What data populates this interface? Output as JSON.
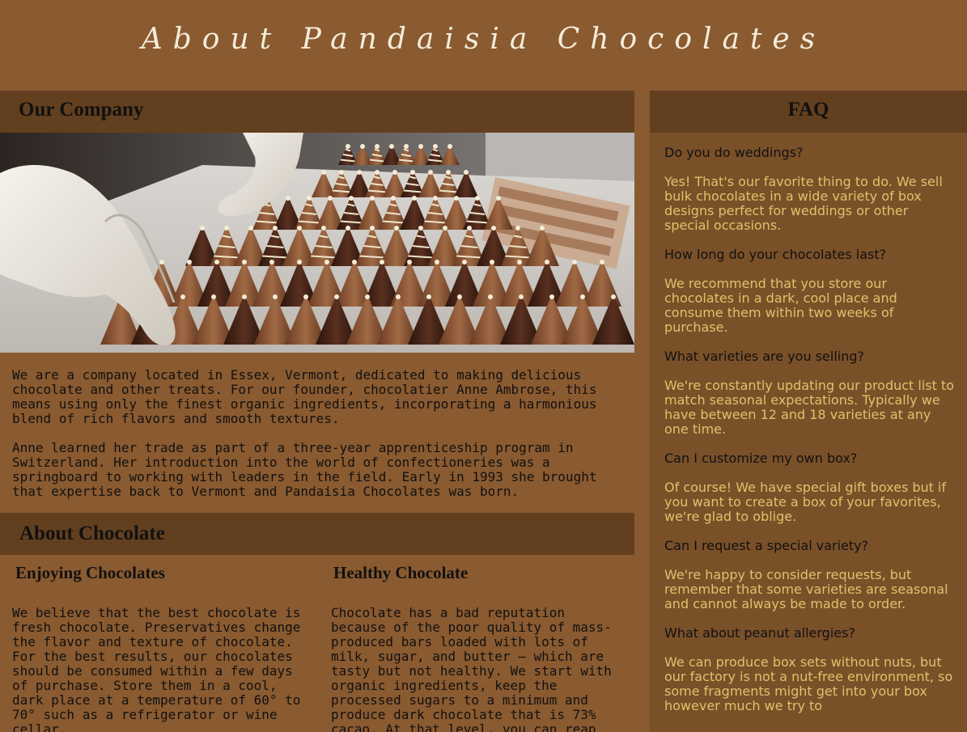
{
  "header": {
    "title": "About Pandaisia Chocolates"
  },
  "company": {
    "heading": "Our Company",
    "image_alt": "Chocolatier arranging striped chocolate cones on a tray",
    "paragraphs": [
      "We are a company located in Essex, Vermont, dedicated to making delicious chocolate and other treats. For our founder, chocolatier Anne Ambrose, this means using only the finest organic ingredients, incorporating a harmonious blend of rich flavors and smooth textures.",
      "Anne learned her trade as part of a three-year apprenticeship program in Switzerland. Her introduction into the world of confectioneries was a springboard to working with leaders in the field. Early in 1993 she brought that expertise back to Vermont and Pandaisia Chocolates was born."
    ]
  },
  "about_chocolate": {
    "heading": "About Chocolate",
    "enjoying": {
      "heading": "Enjoying Chocolates",
      "text": "We believe that the best chocolate is fresh chocolate. Preservatives change the flavor and texture of chocolate. For the best results, our chocolates should be consumed within a few days of purchase. Store them in a cool, dark place at a temperature of 60° to 70° such as a refrigerator or wine cellar."
    },
    "healthy": {
      "heading": "Healthy Chocolate",
      "text": "Chocolate has a bad reputation because of the poor quality of mass-produced bars loaded with lots of milk, sugar, and butter — which are tasty but not healthy. We start with organic ingredients, keep the processed sugars to a minimum and produce dark chocolate that is 73% cacao. At that level, you can reap the benefits of a"
    }
  },
  "faq": {
    "heading": "FAQ",
    "items": [
      {
        "q": "Do you do weddings?",
        "a": "Yes! That's our favorite thing to do. We sell bulk chocolates in a wide variety of box designs perfect for weddings or other special occasions."
      },
      {
        "q": "How long do your chocolates last?",
        "a": "We recommend that you store our chocolates in a dark, cool place and consume them within two weeks of purchase."
      },
      {
        "q": "What varieties are you selling?",
        "a": "We're constantly updating our product list to match seasonal expectations. Typically we have between 12 and 18 varieties at any one time."
      },
      {
        "q": "Can I customize my own box?",
        "a": "Of course! We have special gift boxes but if you want to create a box of your favorites, we're glad to oblige."
      },
      {
        "q": "Can I request a special variety?",
        "a": "We're happy to consider requests, but remember that some varieties are seasonal and cannot always be made to order."
      },
      {
        "q": "What about peanut allergies?",
        "a": "We can produce box sets without nuts, but our factory is not a nut-free environment, so some fragments might get into your box however much we try to"
      }
    ]
  },
  "colors": {
    "page_background": "#8a5a30",
    "section_bar": "#623f1f",
    "aside_background": "#7a5029",
    "title_text": "#f4ecd8",
    "faq_answer": "#e3c06a"
  }
}
